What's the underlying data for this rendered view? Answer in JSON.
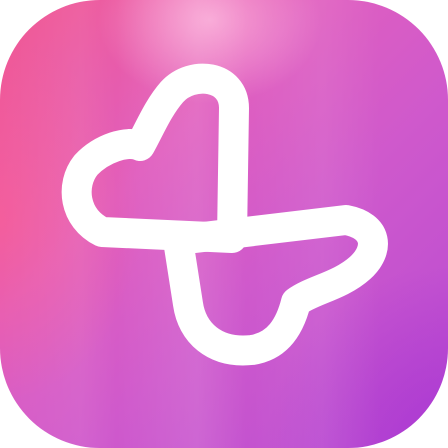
{
  "app_icon": {
    "icon": "twin-hearts-logo-icon",
    "colors": {
      "gradient_start": "#f2568f",
      "gradient_mid": "#d85ac8",
      "gradient_end": "#b64ad3",
      "glyph": "#ffffff"
    }
  }
}
